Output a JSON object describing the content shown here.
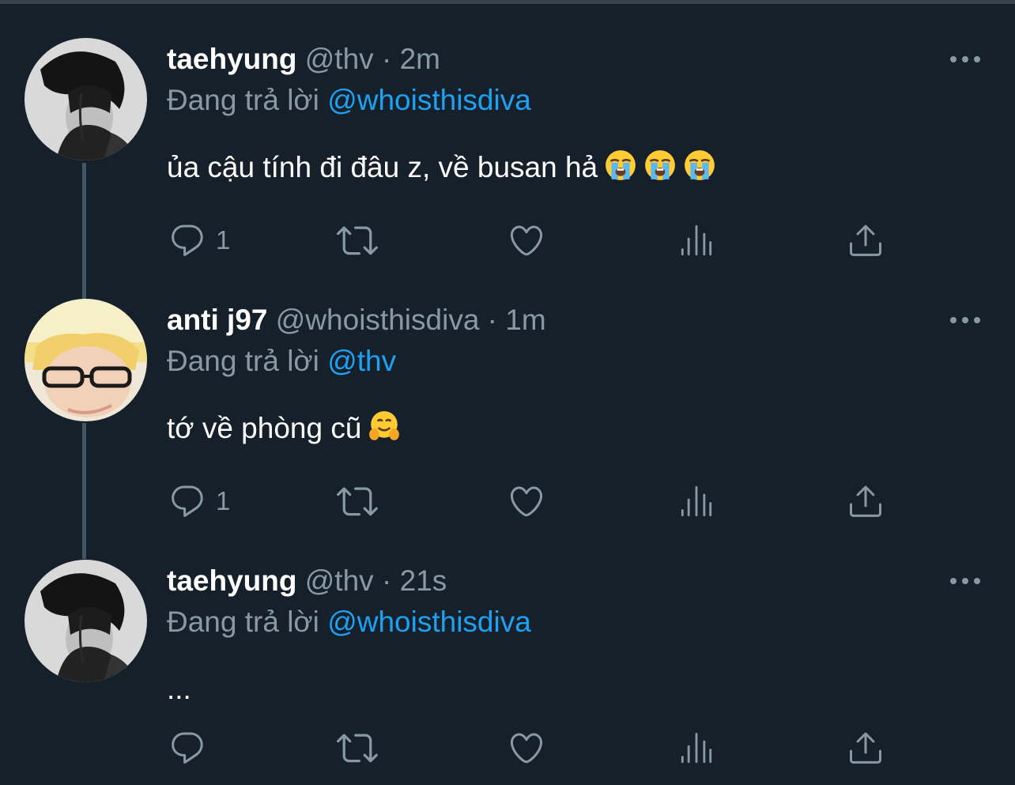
{
  "colors": {
    "background": "#15202b",
    "muted": "#8899a6",
    "accent": "#1da1f2",
    "thread_line": "#425566"
  },
  "tweets": [
    {
      "name": "taehyung",
      "handle": "@thv",
      "separator": "·",
      "time": "2m",
      "reply_prefix": "Đang trả lời",
      "reply_mention": "@whoisthisdiva",
      "text": "ủa cậu tính đi đâu z, về busan hả",
      "emojis": [
        "loudly-crying-face",
        "loudly-crying-face",
        "loudly-crying-face"
      ],
      "reply_count": "1",
      "avatar": "dark-haired-person-photo"
    },
    {
      "name": "anti j97",
      "handle": "@whoisthisdiva",
      "separator": "·",
      "time": "1m",
      "reply_prefix": "Đang trả lời",
      "reply_mention": "@thv",
      "text": "tớ về phòng cũ",
      "emojis": [
        "hugging-face"
      ],
      "reply_count": "1",
      "avatar": "blond-person-with-glasses-photo"
    },
    {
      "name": "taehyung",
      "handle": "@thv",
      "separator": "·",
      "time": "21s",
      "reply_prefix": "Đang trả lời",
      "reply_mention": "@whoisthisdiva",
      "text": "...",
      "emojis": [],
      "reply_count": "",
      "avatar": "dark-haired-person-photo"
    }
  ],
  "icons": {
    "reply": "reply-icon",
    "retweet": "retweet-icon",
    "like": "heart-icon",
    "analytics": "analytics-icon",
    "share": "share-icon",
    "more": "more-icon"
  }
}
